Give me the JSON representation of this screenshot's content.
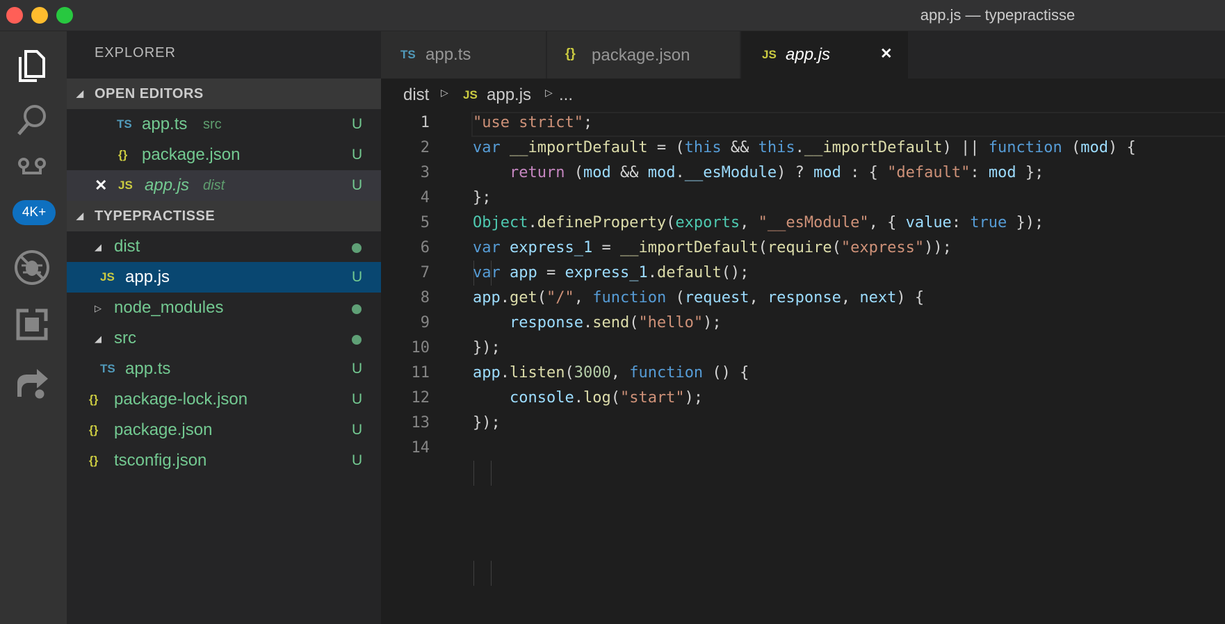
{
  "window": {
    "title": "app.js — typepractisse",
    "traffic_lights": {
      "close": "#ff5f57",
      "minimize": "#febc2e",
      "zoom": "#28c840"
    }
  },
  "activity_bar": {
    "icons": [
      "files-icon",
      "search-icon",
      "source-control-icon",
      "debug-icon",
      "extensions-icon",
      "live-share-icon"
    ],
    "source_control_badge": "4K+"
  },
  "sidebar": {
    "title": "EXPLORER",
    "open_editors": {
      "label": "OPEN EDITORS",
      "items": [
        {
          "icon": "TS",
          "name": "app.ts",
          "desc": "src",
          "status": "U"
        },
        {
          "icon": "{}",
          "name": "package.json",
          "desc": "",
          "status": "U"
        },
        {
          "icon": "JS",
          "name": "app.js",
          "desc": "dist",
          "status": "U",
          "close": "✕"
        }
      ]
    },
    "project": {
      "label": "TYPEPRACTISSE",
      "items": [
        {
          "name": "dist",
          "type": "folder",
          "status": "dot"
        },
        {
          "icon": "JS",
          "name": "app.js",
          "type": "file",
          "status": "U"
        },
        {
          "name": "node_modules",
          "type": "folder",
          "status": "dot"
        },
        {
          "name": "src",
          "type": "folder",
          "status": "dot"
        },
        {
          "icon": "TS",
          "name": "app.ts",
          "type": "file",
          "status": "U"
        },
        {
          "icon": "{}",
          "name": "package-lock.json",
          "type": "file",
          "status": "U"
        },
        {
          "icon": "{}",
          "name": "package.json",
          "type": "file",
          "status": "U"
        },
        {
          "icon": "{}",
          "name": "tsconfig.json",
          "type": "file",
          "status": "U"
        }
      ]
    }
  },
  "tabs": [
    {
      "icon": "TS",
      "label": "app.ts"
    },
    {
      "icon": "{}",
      "label": "package.json"
    },
    {
      "icon": "JS",
      "label": "app.js",
      "close": "✕"
    }
  ],
  "breadcrumb": {
    "folder": "dist",
    "file_icon": "JS",
    "file": "app.js",
    "more": "..."
  },
  "editor": {
    "line_numbers": [
      "1",
      "2",
      "3",
      "4",
      "5",
      "6",
      "7",
      "8",
      "9",
      "10",
      "11",
      "12",
      "13",
      "14"
    ],
    "lines": [
      "\"use strict\";",
      "var __importDefault = (this && this.__importDefault) || function (mod) {",
      "    return (mod && mod.__esModule) ? mod : { \"default\": mod };",
      "};",
      "Object.defineProperty(exports, \"__esModule\", { value: true });",
      "var express_1 = __importDefault(require(\"express\"));",
      "var app = express_1.default();",
      "app.get(\"/\", function (request, response, next) {",
      "    response.send(\"hello\");",
      "});",
      "app.listen(3000, function () {",
      "    console.log(\"start\");",
      "});",
      ""
    ]
  },
  "colors": {
    "accent": "#0e70c0",
    "git_untracked": "#73c991",
    "ts_icon": "#519aba",
    "js_icon": "#cbcb41",
    "json_icon": "#cbcb41"
  }
}
